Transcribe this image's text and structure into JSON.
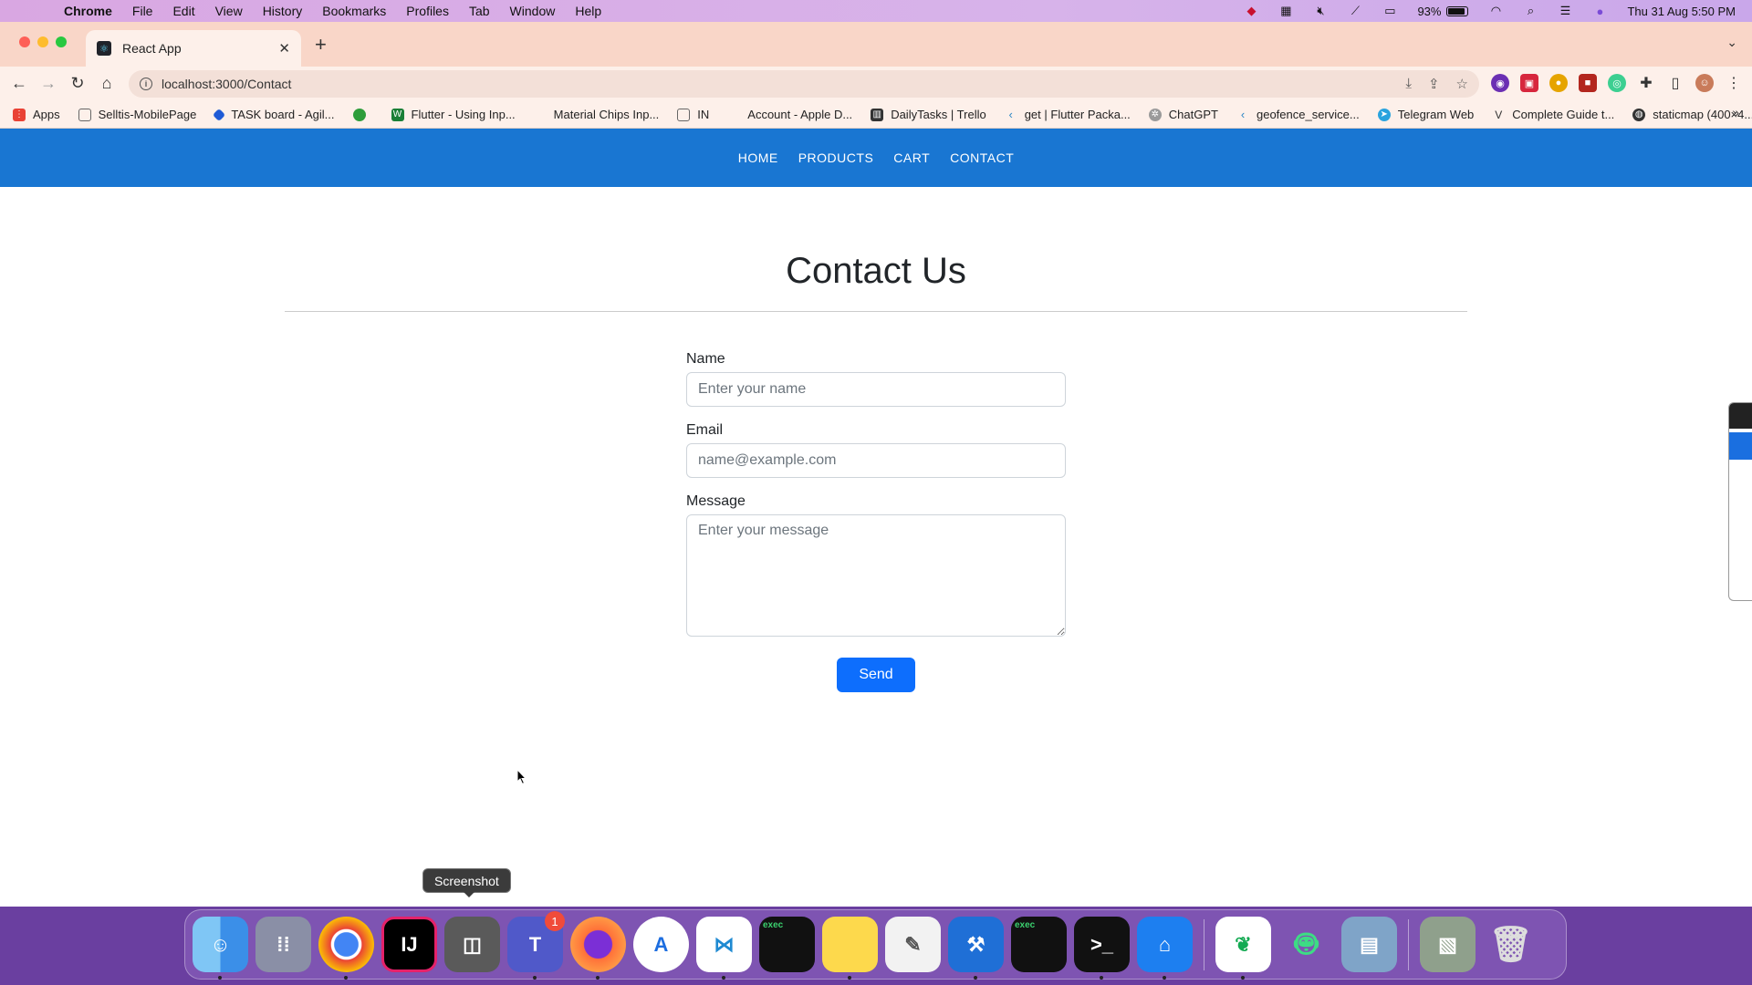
{
  "menubar": {
    "app_name": "Chrome",
    "items": [
      "File",
      "Edit",
      "View",
      "History",
      "Bookmarks",
      "Profiles",
      "Tab",
      "Window",
      "Help"
    ],
    "battery": "93%",
    "datetime": "Thu 31 Aug  5:50 PM"
  },
  "browser": {
    "tab_title": "React App",
    "url": "localhost:3000/Contact",
    "bookmarks": [
      {
        "label": "Apps",
        "icon": "apps-grid-icon",
        "color": "#e94235"
      },
      {
        "label": "Selltis-MobilePage",
        "icon": "folder-icon",
        "color": "#666666"
      },
      {
        "label": "TASK board - Agil...",
        "icon": "diamond-icon",
        "color": "#1f5bd6"
      },
      {
        "label": "",
        "icon": "green-circle-icon",
        "color": "#2e9d3a"
      },
      {
        "label": "Flutter - Using Inp...",
        "icon": "w-icon",
        "color": "#1a7f37"
      },
      {
        "label": "Material Chips Inp...",
        "icon": "",
        "color": "#ffffff"
      },
      {
        "label": "IN",
        "icon": "folder-icon",
        "color": "#666666"
      },
      {
        "label": "Account - Apple D...",
        "icon": "apple-icon",
        "color": "#333333"
      },
      {
        "label": "DailyTasks | Trello",
        "icon": "trello-icon",
        "color": "#333333"
      },
      {
        "label": "get | Flutter Packa...",
        "icon": "flutter-icon",
        "color": "#2b86c5"
      },
      {
        "label": "ChatGPT",
        "icon": "chatgpt-icon",
        "color": "#9a9a9a"
      },
      {
        "label": "geofence_service...",
        "icon": "flutter-icon",
        "color": "#2b86c5"
      },
      {
        "label": "Telegram Web",
        "icon": "telegram-icon",
        "color": "#2aa3de"
      },
      {
        "label": "Complete Guide t...",
        "icon": "v-icon",
        "color": "#333333"
      },
      {
        "label": "staticmap (400×4...",
        "icon": "globe-icon",
        "color": "#333333"
      }
    ]
  },
  "site": {
    "nav": [
      "HOME",
      "PRODUCTS",
      "CART",
      "CONTACT"
    ],
    "title": "Contact Us",
    "form": {
      "name_label": "Name",
      "name_placeholder": "Enter your name",
      "email_label": "Email",
      "email_placeholder": "name@example.com",
      "message_label": "Message",
      "message_placeholder": "Enter your message",
      "submit_label": "Send"
    }
  },
  "dock": {
    "tooltip": "Screenshot",
    "teams_badge": "1",
    "exec_label": "exec"
  },
  "colors": {
    "navbar": "#1976d2",
    "send_button": "#0d6efd"
  }
}
